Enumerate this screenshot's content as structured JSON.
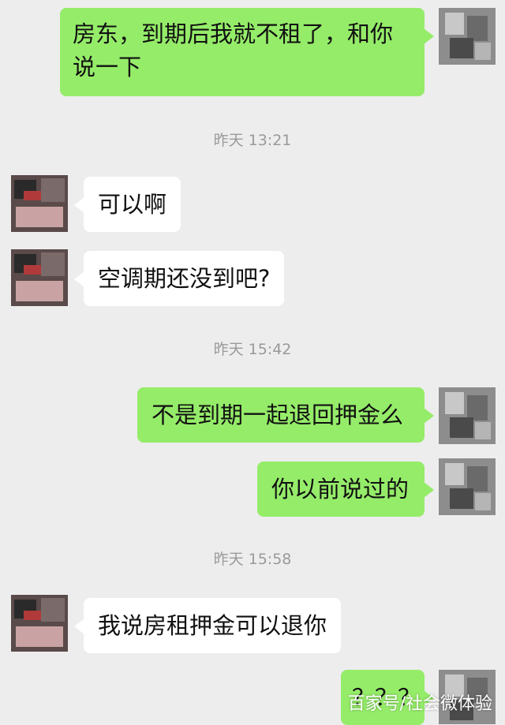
{
  "messages": [
    {
      "side": "right",
      "text": "房东，到期后我就不租了，和你说一下"
    },
    {
      "side": "left",
      "text": "可以啊"
    },
    {
      "side": "left",
      "text": "空调期还没到吧?"
    },
    {
      "side": "right",
      "text": "不是到期一起退回押金么"
    },
    {
      "side": "right",
      "text": "你以前说过的"
    },
    {
      "side": "left",
      "text": "我说房租押金可以退你"
    },
    {
      "side": "right",
      "text": "？？？"
    }
  ],
  "timestamps": [
    "昨天 13:21",
    "昨天 15:42",
    "昨天 15:58"
  ],
  "watermark": "百家号/社会微体验",
  "colors": {
    "background": "#ededed",
    "sent_bubble": "#95ec69",
    "received_bubble": "#ffffff",
    "timestamp": "#9a9a9a"
  }
}
